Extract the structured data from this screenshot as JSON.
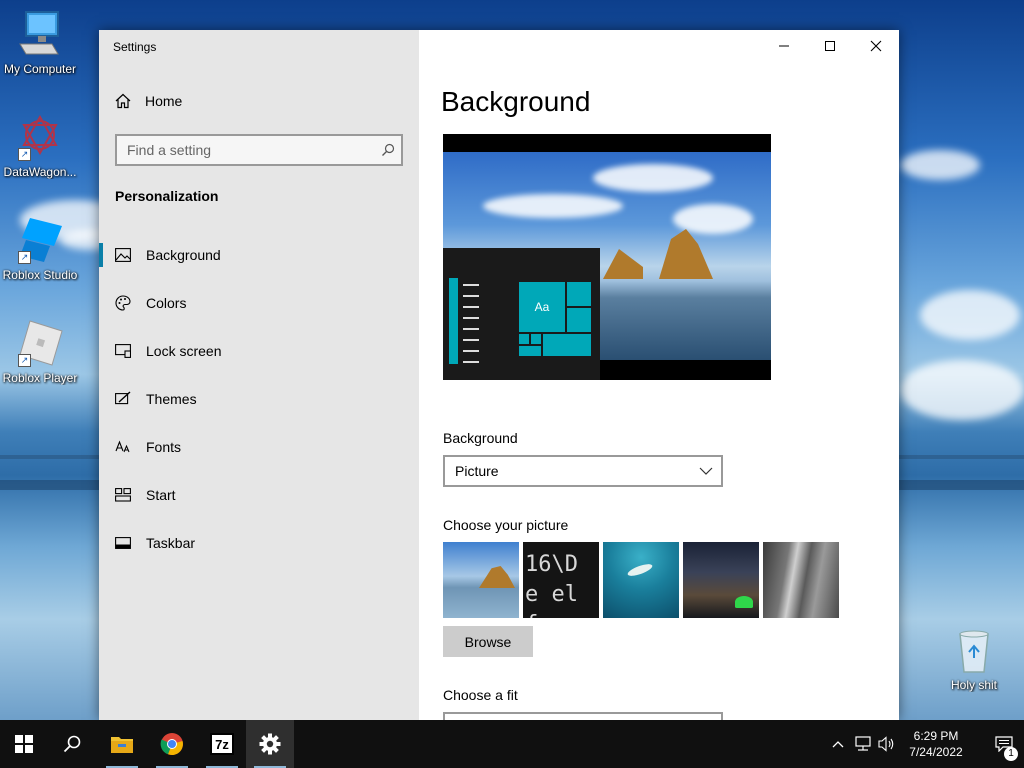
{
  "desktop": {
    "icons": [
      {
        "label": "My Computer",
        "icon": "computer-icon"
      },
      {
        "label": "DataWagon...",
        "icon": "datawagon-icon"
      },
      {
        "label": "Roblox Studio",
        "icon": "roblox-studio-icon"
      },
      {
        "label": "Roblox Player",
        "icon": "roblox-player-icon"
      },
      {
        "label": "Holy shit",
        "icon": "recycle-bin-icon"
      }
    ]
  },
  "window": {
    "title": "Settings",
    "controls": {
      "minimize": "minimize-icon",
      "maximize": "maximize-icon",
      "close": "close-icon"
    }
  },
  "sidebar": {
    "home_label": "Home",
    "search_placeholder": "Find a setting",
    "section_title": "Personalization",
    "items": [
      {
        "label": "Background",
        "icon": "picture-icon",
        "active": true
      },
      {
        "label": "Colors",
        "icon": "palette-icon",
        "active": false
      },
      {
        "label": "Lock screen",
        "icon": "lock-screen-icon",
        "active": false
      },
      {
        "label": "Themes",
        "icon": "themes-icon",
        "active": false
      },
      {
        "label": "Fonts",
        "icon": "fonts-icon",
        "active": false
      },
      {
        "label": "Start",
        "icon": "start-icon",
        "active": false
      },
      {
        "label": "Taskbar",
        "icon": "taskbar-icon",
        "active": false
      }
    ]
  },
  "main": {
    "page_title": "Background",
    "preview": {
      "tile_text": "Aa"
    },
    "background_label": "Background",
    "background_value": "Picture",
    "choose_picture_label": "Choose your picture",
    "thumb2_text": "16\\De elf",
    "browse_label": "Browse",
    "choose_fit_label": "Choose a fit"
  },
  "taskbar": {
    "items": [
      "start-icon",
      "search-icon",
      "file-explorer-icon",
      "chrome-icon",
      "7zip-icon",
      "settings-icon"
    ],
    "zip_label": "7z",
    "time": "6:29 PM",
    "date": "7/24/2022",
    "notification_count": "1"
  },
  "colors": {
    "accent": "#0a7fa8",
    "tile": "#00a8b8",
    "taskbar": "#101010",
    "sidebar": "#e6e6e6"
  }
}
